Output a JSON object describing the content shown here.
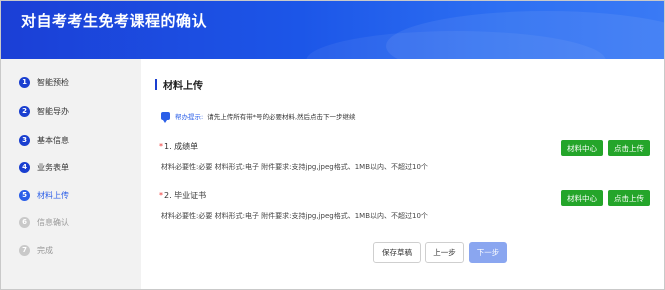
{
  "header": {
    "title": "对自考考生免考课程的确认"
  },
  "sidebar": {
    "steps": [
      {
        "num": "1",
        "label": "智能预检",
        "state": "done"
      },
      {
        "num": "2",
        "label": "智能导办",
        "state": "done"
      },
      {
        "num": "3",
        "label": "基本信息",
        "state": "done"
      },
      {
        "num": "4",
        "label": "业务表单",
        "state": "done"
      },
      {
        "num": "5",
        "label": "材料上传",
        "state": "active"
      },
      {
        "num": "6",
        "label": "信息确认",
        "state": "pending"
      },
      {
        "num": "7",
        "label": "完成",
        "state": "pending"
      }
    ]
  },
  "main": {
    "section_title": "材料上传",
    "tip": {
      "key": "帮办提示:",
      "message": "请先上传所有带*号的必要材料,然后点击下一步继续"
    },
    "materials": [
      {
        "required_mark": "*",
        "title": "1. 成绩单",
        "desc": "材料必要性:必要   材料形式:电子   附件要求:支持jpg,jpeg格式、1MB以内、不超过10个",
        "center_label": "材料中心",
        "upload_label": "点击上传"
      },
      {
        "required_mark": "*",
        "title": "2. 毕业证书",
        "desc": "材料必要性:必要   材料形式:电子   附件要求:支持jpg,jpeg格式、1MB以内、不超过10个",
        "center_label": "材料中心",
        "upload_label": "点击上传"
      }
    ],
    "actions": {
      "save_draft": "保存草稿",
      "prev": "上一步",
      "next": "下一步"
    }
  },
  "colors": {
    "header_blue": "#1c56e8",
    "accent_blue": "#2a5ee8",
    "green": "#24a52a",
    "next_disabled": "#8aa6f0"
  }
}
